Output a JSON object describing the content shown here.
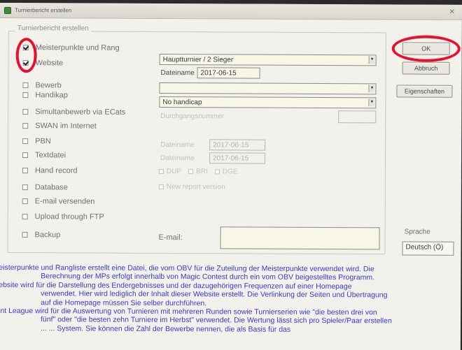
{
  "window": {
    "title": "Turnierbericht erstellen"
  },
  "group_title": "Turnierbericht erstellen",
  "options": [
    {
      "label": "Meisterpunkte und Rang",
      "checked": true
    },
    {
      "label": "Website",
      "checked": true
    },
    {
      "label": "Bewerb",
      "checked": false
    },
    {
      "label": "Handikap",
      "checked": false
    },
    {
      "label": "Simultanbewerb via ECats",
      "checked": false
    },
    {
      "label": "SWAN im Internet",
      "checked": false
    },
    {
      "label": "PBN",
      "checked": false
    },
    {
      "label": "Textdatei",
      "checked": false
    },
    {
      "label": "Hand record",
      "checked": false
    },
    {
      "label": "Database",
      "checked": false
    },
    {
      "label": "E-mail versenden",
      "checked": false
    },
    {
      "label": "Upload through FTP",
      "checked": false
    },
    {
      "label": "Backup",
      "checked": false
    }
  ],
  "fields": {
    "rank_select": "Hauptturnier / 2 Sieger",
    "filename_label_1": "Dateiname",
    "filename_value_1": "2017-06-15",
    "bewerb_select": "",
    "handicap_select": "No handicap",
    "durchgang_label": "Durchgangsnummer",
    "durchgang_value": "",
    "filename_label_pbn": "Dateiname",
    "filename_value_pbn": "2017-06-15",
    "filename_label_txt": "Dateiname",
    "filename_value_txt": "2017-06-15",
    "hand_dup": "DUP",
    "hand_bri": "BRI",
    "hand_dge": "DGE",
    "new_report": "New report version",
    "email_label": "E-mail:",
    "email_value": ""
  },
  "buttons": {
    "ok": "OK",
    "cancel": "Abbruch",
    "properties": "Eigenschaften"
  },
  "language": {
    "label": "Sprache",
    "value": "Deutsch (Ö)"
  },
  "description_lines": [
    "eisterpunkte und Rangliste erstellt eine Datei, die vom OBV für die Zuteilung der Meisterpunkte verwendet wird. Die",
    "Berechnung der MPs erfolgt innerhalb von Magic Contest durch ein vom OBV beigestelltes Programm.",
    "ebsite wird für die Darstellung des Endergebnisses und der dazugehörigen Frequenzen auf einer Homepage",
    "verwendet. Hier wird lediglich der Inhalt dieser Website erstellt. Die Verlinkung der Seiten und Übertragung",
    "auf die Homepage müssen Sie selber durchführen.",
    "int League wird für die Auswertung von Turnieren mit mehreren Runden sowie Turnierserien wie \"die besten drei von",
    "fünf\" oder \"die besten zehn Turniere im Herbst\" verwendet. Die Wertung lässt sich pro Spieler/Paar erstellen",
    "... ... System. Sie können die Zahl der Bewerbe nennen, die als Basis für das"
  ],
  "colors": {
    "description_text": "#3a3ad0",
    "annotation": "#e8112d",
    "dialog_bg": "#f2f1ec"
  }
}
